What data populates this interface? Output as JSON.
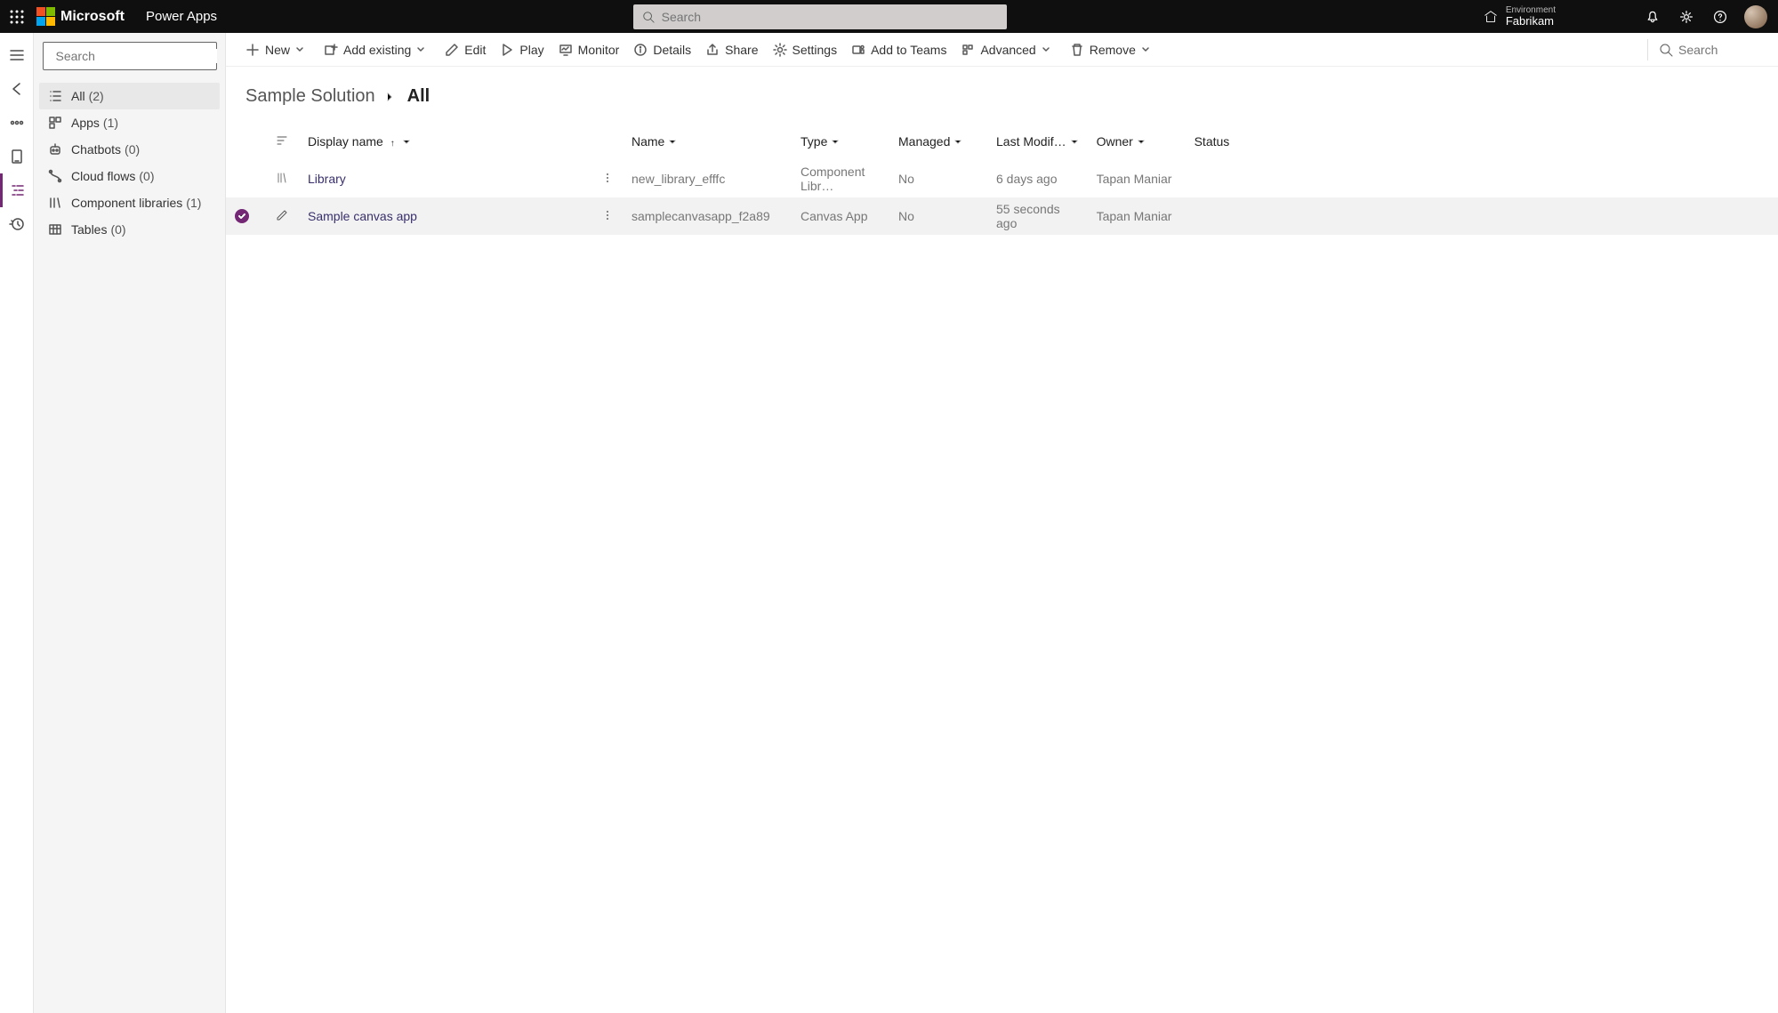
{
  "header": {
    "microsoft": "Microsoft",
    "app_name": "Power Apps",
    "search_placeholder": "Search",
    "env_label": "Environment",
    "env_name": "Fabrikam"
  },
  "sidebar": {
    "search_placeholder": "Search",
    "items": [
      {
        "label": "All",
        "count": "(2)",
        "icon": "list"
      },
      {
        "label": "Apps",
        "count": "(1)",
        "icon": "app"
      },
      {
        "label": "Chatbots",
        "count": "(0)",
        "icon": "bot"
      },
      {
        "label": "Cloud flows",
        "count": "(0)",
        "icon": "flow"
      },
      {
        "label": "Component libraries",
        "count": "(1)",
        "icon": "lib"
      },
      {
        "label": "Tables",
        "count": "(0)",
        "icon": "table"
      }
    ]
  },
  "commands": {
    "new": "New",
    "add_existing": "Add existing",
    "edit": "Edit",
    "play": "Play",
    "monitor": "Monitor",
    "details": "Details",
    "share": "Share",
    "settings": "Settings",
    "add_to_teams": "Add to Teams",
    "advanced": "Advanced",
    "remove": "Remove",
    "search_placeholder": "Search"
  },
  "breadcrumb": {
    "root": "Sample Solution",
    "current": "All"
  },
  "columns": {
    "display_name": "Display name",
    "name": "Name",
    "type": "Type",
    "managed": "Managed",
    "last_modified": "Last Modif…",
    "owner": "Owner",
    "status": "Status"
  },
  "rows": [
    {
      "selected": false,
      "display": "Library",
      "name": "new_library_efffc",
      "type": "Component Libr…",
      "managed": "No",
      "modified": "6 days ago",
      "owner": "Tapan Maniar",
      "status": "",
      "icon": "lib"
    },
    {
      "selected": true,
      "display": "Sample canvas app",
      "name": "samplecanvasapp_f2a89",
      "type": "Canvas App",
      "managed": "No",
      "modified": "55 seconds ago",
      "owner": "Tapan Maniar",
      "status": "",
      "icon": "edit"
    }
  ]
}
